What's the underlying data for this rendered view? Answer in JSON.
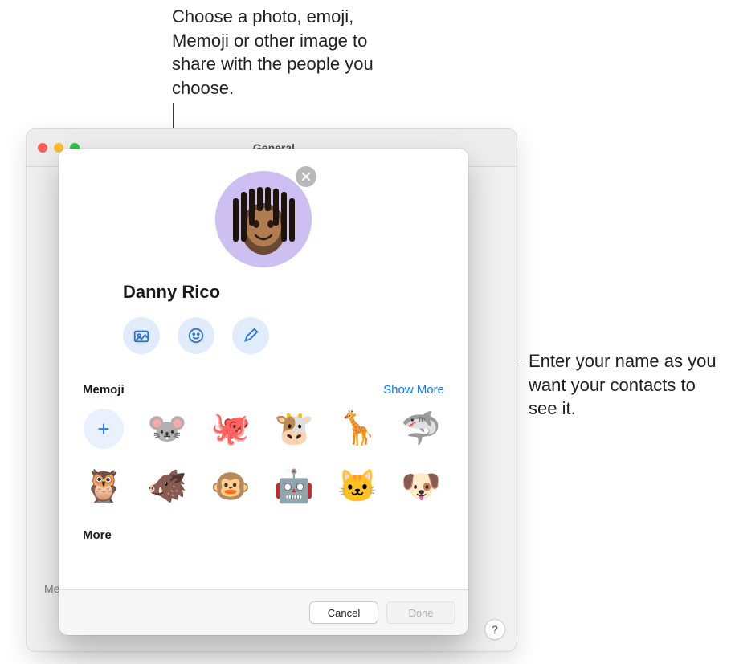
{
  "parent_window": {
    "title": "General",
    "footer_label": "Me",
    "help_label": "?"
  },
  "modal": {
    "user_name": "Danny Rico",
    "avatar_clear_label": "×",
    "action_buttons": {
      "photo": "photo-button",
      "emoji": "emoji-button",
      "edit": "edit-button"
    },
    "memoji": {
      "title": "Memoji",
      "show_more": "Show More",
      "add_label": "+",
      "items": [
        "🐭",
        "🐙",
        "🐮",
        "🦒",
        "🦈",
        "🦉",
        "🐗",
        "🐵",
        "🤖",
        "🐱",
        "🐶"
      ]
    },
    "more_label": "More",
    "buttons": {
      "cancel": "Cancel",
      "done": "Done"
    }
  },
  "callouts": {
    "top": "Choose a photo, emoji, Memoji or other image to share with the people you choose.",
    "right": "Enter your name as you want your contacts to see it."
  }
}
